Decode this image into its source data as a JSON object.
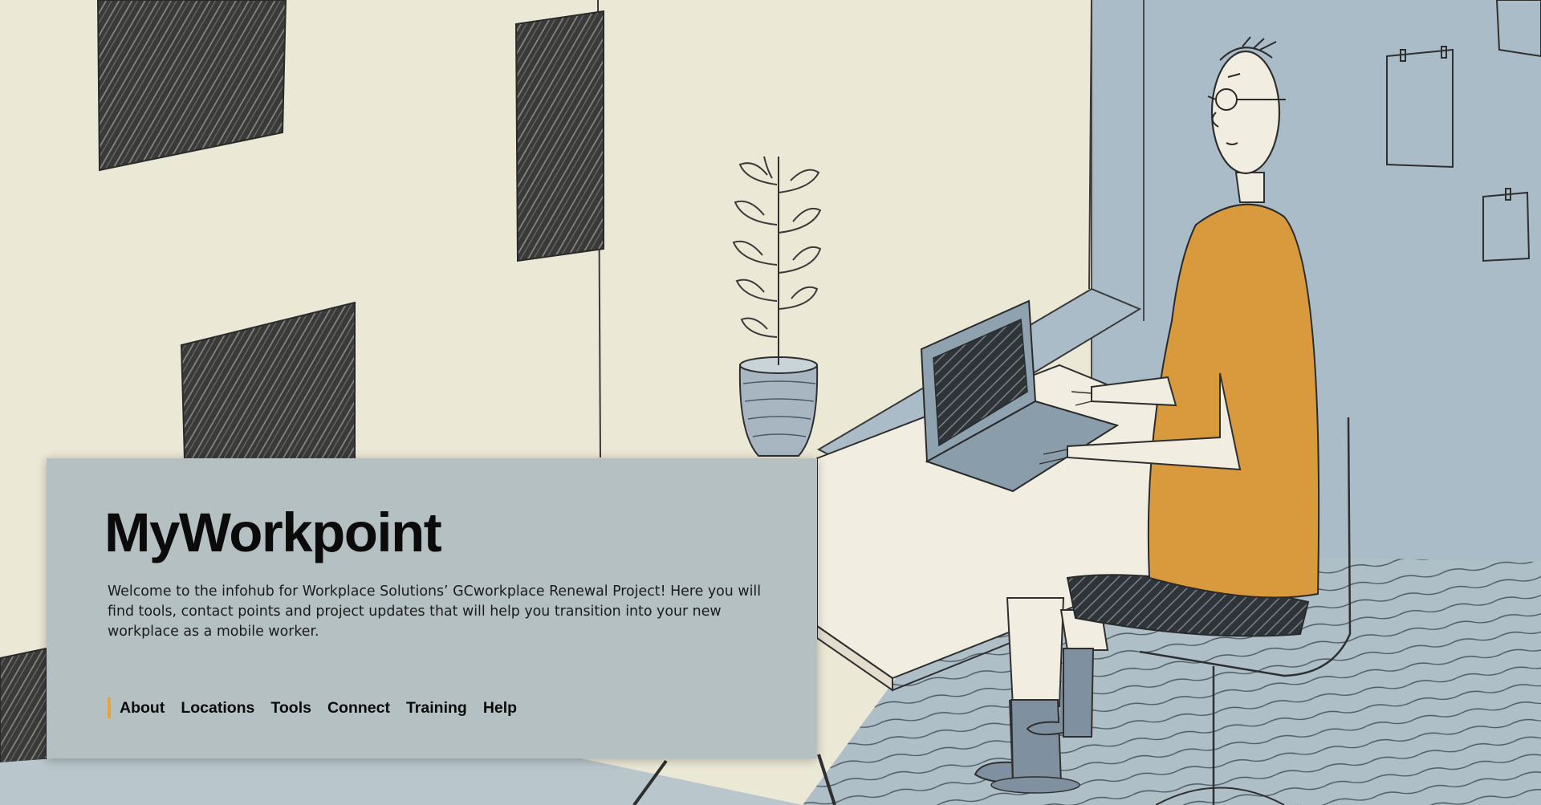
{
  "hero": {
    "title": "MyWorkpoint",
    "intro": "Welcome to the infohub for Workplace Solutions’ GCworkplace Renewal Project! Here you will find tools, contact points and project updates that will help you transition into your new workplace as a mobile worker."
  },
  "nav": {
    "items": [
      {
        "label": "About"
      },
      {
        "label": "Locations"
      },
      {
        "label": "Tools"
      },
      {
        "label": "Connect"
      },
      {
        "label": "Training"
      },
      {
        "label": "Help"
      }
    ]
  },
  "colors": {
    "accent": "#e5a43a",
    "card_bg": "#b4c0c2",
    "wall": "#ece8d6",
    "wall_blue": "#a9bcc7",
    "shirt": "#d89a3c"
  },
  "illustration": {
    "subject": "person-at-laptop-illustration"
  }
}
